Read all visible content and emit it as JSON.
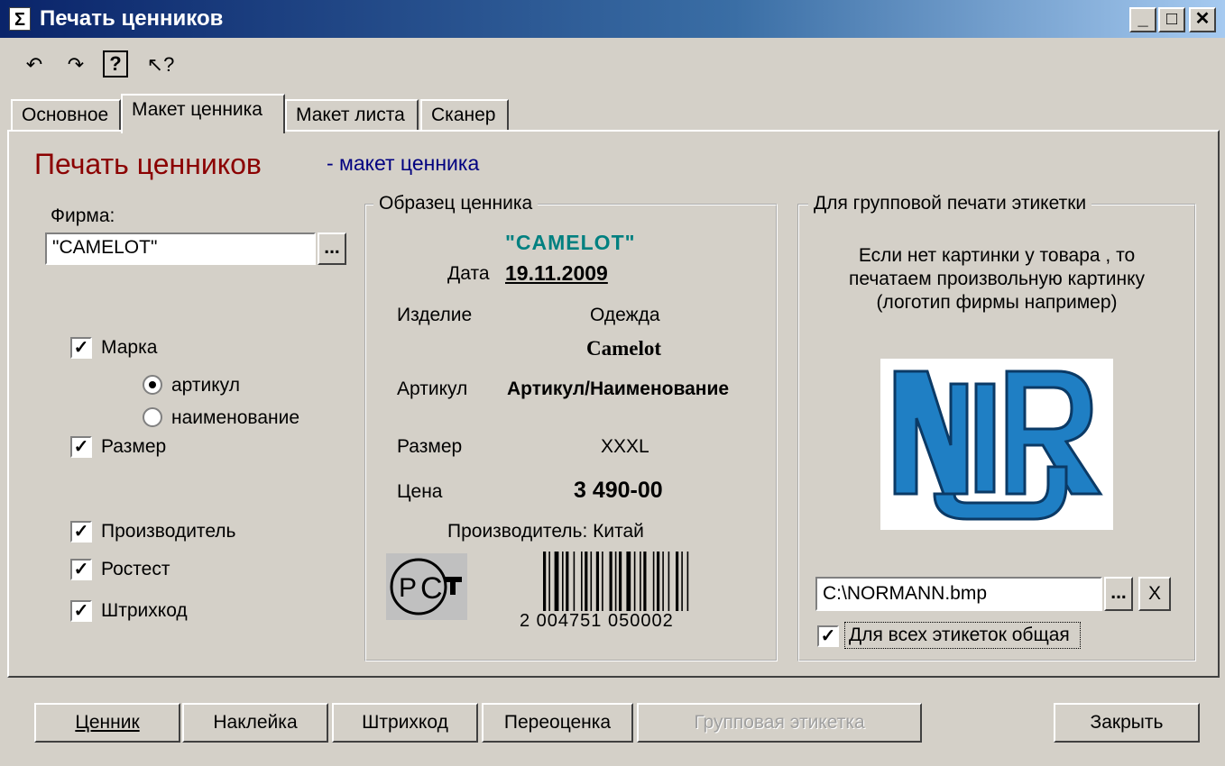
{
  "window": {
    "title": "Печать ценников",
    "icon": "sigma-icon",
    "controls": [
      "_",
      "□",
      "✕"
    ]
  },
  "toolbar": {
    "icons": [
      "undo-icon",
      "redo-icon",
      "help-icon",
      "context-help-icon"
    ],
    "glyphs": [
      "↶",
      "↷",
      "?",
      "↖?"
    ]
  },
  "tabs": [
    "Основное",
    "Макет ценника",
    "Макет листа",
    "Сканер"
  ],
  "header": {
    "title": "Печать ценников",
    "subtitle": "- макет ценника"
  },
  "firm": {
    "label": "Фирма:",
    "value": "\"CAMELOT\"",
    "browse": "..."
  },
  "options": {
    "marka": "Марка",
    "articul": "артикул",
    "naimenovanie": "наименование",
    "razmer": "Размер",
    "proizvoditel": "Производитель",
    "rostest": "Ростест",
    "shtrihkod": "Штрихкод"
  },
  "sample": {
    "legend": "Образец ценника",
    "firm": "\"CAMELOT\"",
    "date_label": "Дата",
    "date_value": "19.11.2009",
    "item_label": "Изделие",
    "item_value": "Одежда",
    "brand": "Camelot",
    "articul_label": "Артикул",
    "articul_value": "Артикул/Наименование",
    "size_label": "Размер",
    "size_value": "XXXL",
    "price_label": "Цена",
    "price_value": "3 490-00",
    "manufacturer": "Производитель: Китай",
    "barcode_number": "2 004751 050002",
    "pct_mark": "РСТ"
  },
  "group_print": {
    "legend": "Для групповой печати этикетки",
    "description_1": "Если нет картинки у товара , то",
    "description_2": "печатаем произвольную картинку",
    "description_3": "(логотип фирмы например)",
    "logo_text": "NiR",
    "file_path": "C:\\NORMANN.bmp",
    "browse": "...",
    "clear": "X",
    "all_labels": "Для всех этикеток общая"
  },
  "buttons": {
    "cennik": "Ценник",
    "nakleika": "Наклейка",
    "shtrihkod": "Штрихкод",
    "pereocenka": "Переоценка",
    "group_label": "Групповая этикетка",
    "close": "Закрыть"
  }
}
